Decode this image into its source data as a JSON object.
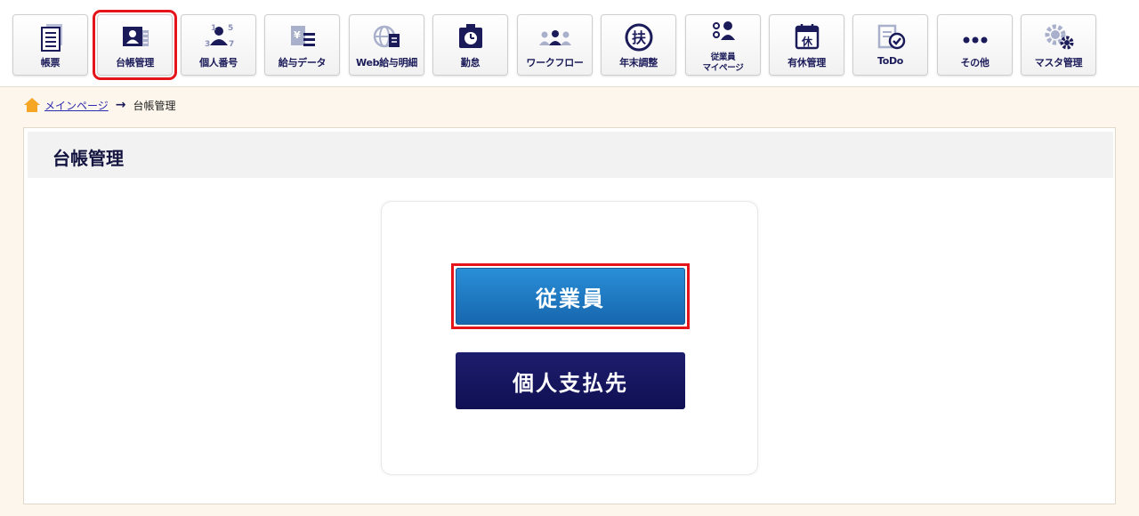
{
  "toolbar": {
    "items": [
      {
        "label": "帳票",
        "icon": "document-icon"
      },
      {
        "label": "台帳管理",
        "icon": "ledger-icon",
        "selected": true
      },
      {
        "label": "個人番号",
        "icon": "my-number-icon"
      },
      {
        "label": "給与データ",
        "icon": "salary-data-icon"
      },
      {
        "label": "Web給与明細",
        "icon": "web-payslip-icon"
      },
      {
        "label": "勤怠",
        "icon": "attendance-icon"
      },
      {
        "label": "ワークフロー",
        "icon": "workflow-icon"
      },
      {
        "label": "年末調整",
        "icon": "year-end-icon"
      },
      {
        "label": "従業員",
        "label2": "マイページ",
        "icon": "employee-mypage-icon"
      },
      {
        "label": "有休管理",
        "icon": "paid-leave-icon"
      },
      {
        "label": "ToDo",
        "icon": "todo-icon"
      },
      {
        "label": "その他",
        "icon": "more-icon"
      },
      {
        "label": "マスタ管理",
        "icon": "master-settings-icon"
      }
    ]
  },
  "breadcrumb": {
    "home": "メインページ",
    "current": "台帳管理"
  },
  "page": {
    "title": "台帳管理"
  },
  "actions": {
    "employee": "従業員",
    "individual_payee": "個人支払先"
  },
  "colors": {
    "accent_blue": "#1f7bc6",
    "navy": "#141460",
    "highlight_red": "#e5141b"
  }
}
